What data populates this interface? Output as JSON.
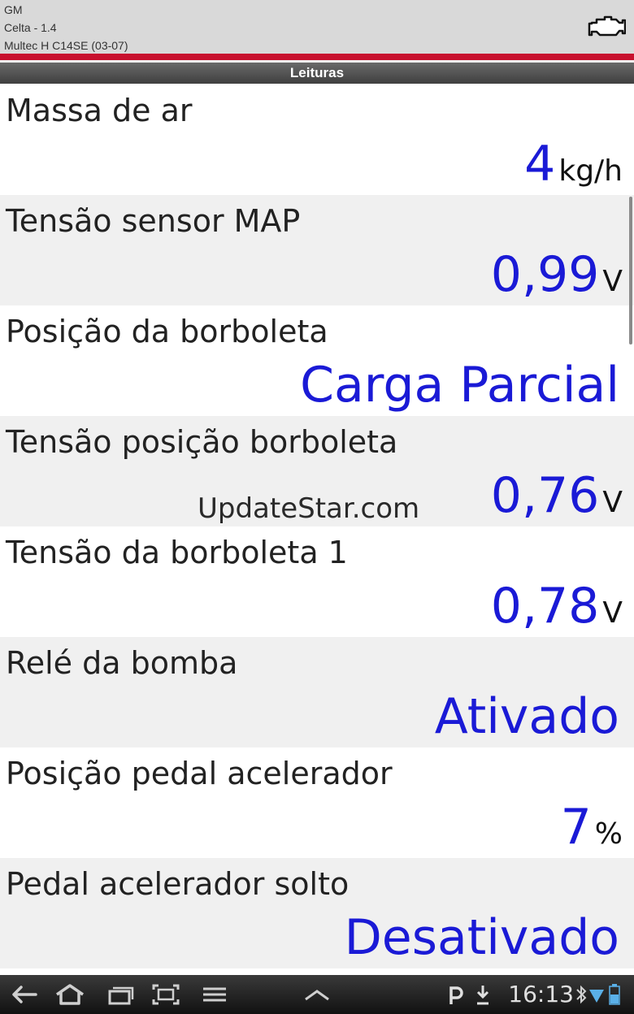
{
  "header": {
    "brand": "GM",
    "model": "Celta  -  1.4",
    "ecu": "Multec H C14SE (03-07)",
    "icon": "engine-icon"
  },
  "section_title": "Leituras",
  "readings": [
    {
      "label": "Massa de ar",
      "value": "4",
      "unit": "kg/h"
    },
    {
      "label": "Tensão sensor MAP",
      "value": "0,99",
      "unit": "V"
    },
    {
      "label": "Posição da borboleta",
      "value": "Carga Parcial",
      "unit": ""
    },
    {
      "label": "Tensão posição borboleta",
      "value": "0,76",
      "unit": "V"
    },
    {
      "label": "Tensão da borboleta 1",
      "value": "0,78",
      "unit": "V"
    },
    {
      "label": "Relé da bomba",
      "value": "Ativado",
      "unit": ""
    },
    {
      "label": "Posição pedal acelerador",
      "value": "7",
      "unit": "%"
    },
    {
      "label": "Pedal acelerador solto",
      "value": "Desativado",
      "unit": ""
    }
  ],
  "watermark": "UpdateStar.com",
  "status_bar": {
    "time": "16:13"
  },
  "colors": {
    "value_blue": "#1a1ad6",
    "accent_red": "#c8102e",
    "row_alt": "#f0f0f0"
  }
}
